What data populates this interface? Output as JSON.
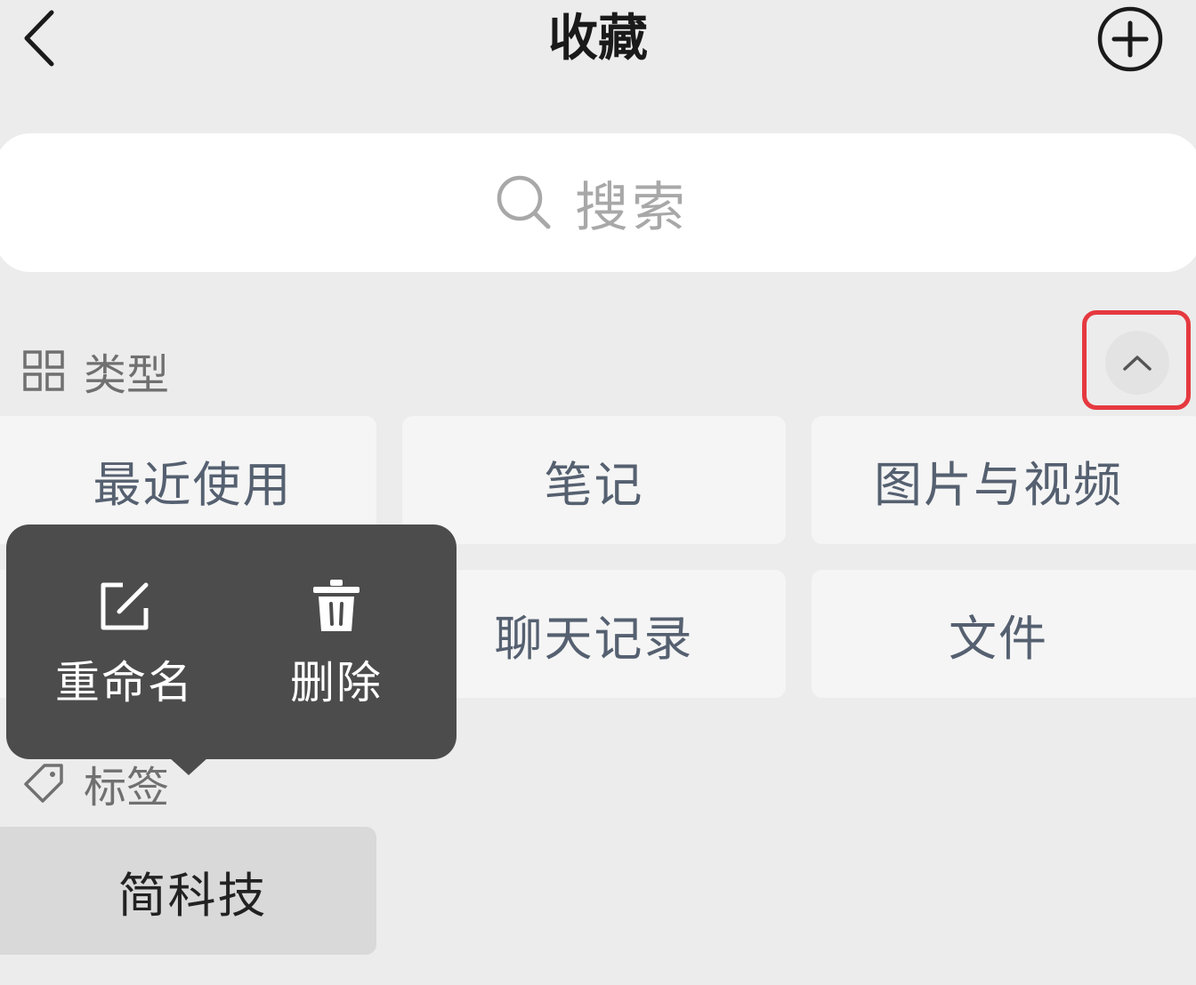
{
  "header": {
    "title": "收藏",
    "back_icon": "chevron-left-icon",
    "add_icon": "plus-circle-icon"
  },
  "search": {
    "placeholder": "搜索",
    "icon": "search-icon"
  },
  "type_section": {
    "label": "类型",
    "icon": "grid-icon",
    "collapse_icon": "chevron-up-icon",
    "items": [
      {
        "label": "最近使用"
      },
      {
        "label": "笔记"
      },
      {
        "label": "图片与视频"
      },
      {
        "label": "聊天记录"
      },
      {
        "label": "文件"
      }
    ]
  },
  "tag_section": {
    "label": "标签",
    "icon": "tag-icon",
    "tags": [
      {
        "label": "简科技"
      }
    ]
  },
  "context_menu": {
    "rename_label": "重命名",
    "rename_icon": "edit-icon",
    "delete_label": "删除",
    "delete_icon": "trash-icon"
  },
  "colors": {
    "background": "#ececec",
    "tile": "#f5f5f5",
    "tile_text": "#556070",
    "popup": "#4c4c4c",
    "highlight": "#e5393f"
  }
}
